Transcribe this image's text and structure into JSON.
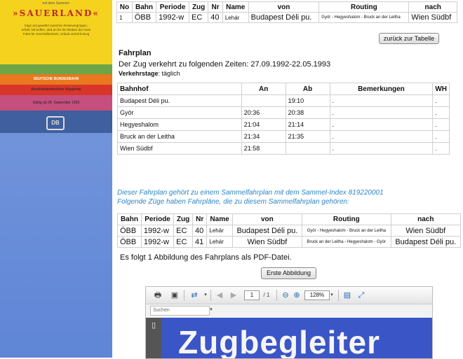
{
  "cover": {
    "top": "mit dem Sammel-",
    "title": "»SAUERLAND«",
    "small": "trägt und gewährt manchen Reisevergnügen, erfüllt, hilt treffen, daß an für Ihn bleiben der Gute Fahrt für Geschäftsreisen, Urlaub und Erholung",
    "band_db": "DEUTSCHE BUNDESBAHN",
    "band_dir": "Bundesbahndirektion Wuppertal",
    "band_valid": "Gültig ab 28. September 1992",
    "db_logo": "DB"
  },
  "top_table": {
    "headers": [
      "No",
      "Bahn",
      "Periode",
      "Zug",
      "Nr",
      "Name",
      "von",
      "Routing",
      "nach"
    ],
    "row": [
      "1",
      "ÖBB",
      "1992-w",
      "EC",
      "40",
      "Lehár",
      "Budapest Déli pu.",
      "Györ - Hegyeshalom - Bruck an der Leitha",
      "Wien Südbf"
    ]
  },
  "back_button": "zurück zur Tabelle",
  "fahrplan": {
    "heading": "Fahrplan",
    "line": "Der Zug verkehrt zu folgenden Zeiten: 27.09.1992-22.05.1993",
    "days_label": "Verkehrstage",
    "days_value": ": täglich",
    "headers": [
      "Bahnhof",
      "An",
      "Ab",
      "Bemerkungen",
      "WH"
    ],
    "rows": [
      [
        "Budapest Déli pu.",
        "",
        "19:10",
        ".",
        "."
      ],
      [
        "Györ",
        "20:36",
        "20:38",
        ".",
        "."
      ],
      [
        "Hegyeshalom",
        "21:04",
        "21:14",
        ".",
        "."
      ],
      [
        "Bruck an der Leitha",
        "21:34",
        "21:35",
        ".",
        "."
      ],
      [
        "Wien Südbf",
        "21:58",
        "",
        ".",
        "."
      ]
    ]
  },
  "sammel": {
    "note1": "Dieser Fahrplan gehört zu einem Sammelfahrplan mit dem Sammel-Index 819220001",
    "note2": "Folgende Züge haben Fahrpläne, die zu diesem Sammelfahrplan gehören:",
    "headers": [
      "Bahn",
      "Periode",
      "Zug",
      "Nr",
      "Name",
      "von",
      "Routing",
      "nach"
    ],
    "rows": [
      [
        "ÖBB",
        "1992-w",
        "EC",
        "40",
        "Lehár",
        "Budapest Déli pu.",
        "Györ - Hegyeshalom - Bruck an der Leitha",
        "Wien Südbf"
      ],
      [
        "ÖBB",
        "1992-w",
        "EC",
        "41",
        "Lehár",
        "Wien Südbf",
        "Bruck an der Leitha - Hegyeshalom - Györ",
        "Budapest Déli pu."
      ]
    ]
  },
  "pdf_line": "Es folgt 1 Abbildung des Fahrplans als PDF-Datei.",
  "first_button": "Erste Abbildung",
  "viewer": {
    "page_num": "1",
    "page_total": "/ 1",
    "zoom": "128%",
    "search_placeholder": "Suchen",
    "page_text": "Zugbegleiter",
    "icons": [
      "print-icon",
      "save-icon",
      "share-icon",
      "prev-page-icon",
      "next-page-icon",
      "zoom-out-icon",
      "zoom-in-icon",
      "disk-icon",
      "fullscreen-icon",
      "thumbnail-icon"
    ]
  }
}
